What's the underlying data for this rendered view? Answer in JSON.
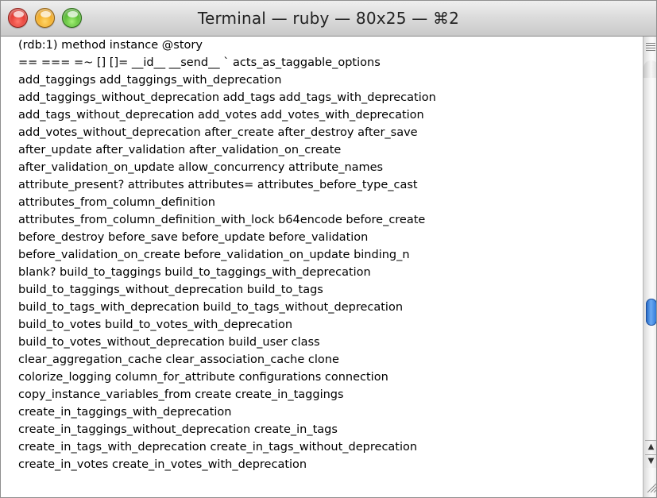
{
  "window": {
    "title": "Terminal — ruby — 80x25 — ⌘2"
  },
  "icons": {
    "close": "close-button",
    "minimize": "minimize-button",
    "zoom": "zoom-button",
    "scroll_up": "arrow-up-icon",
    "scroll_down": "arrow-down-icon",
    "resize": "resize-grip-icon"
  },
  "colors": {
    "scroll_thumb": "#3a86e0",
    "close": "#e0312a",
    "minimize": "#f0a61a",
    "zoom": "#4fb62a"
  },
  "scrollbar": {
    "up_glyph": "▲",
    "down_glyph": "▼"
  },
  "terminal": {
    "lines": [
      "(rdb:1) method instance @story",
      "== === =~ [] []= __id__ __send__ ` acts_as_taggable_options",
      "add_taggings add_taggings_with_deprecation",
      "add_taggings_without_deprecation add_tags add_tags_with_deprecation",
      "add_tags_without_deprecation add_votes add_votes_with_deprecation",
      "add_votes_without_deprecation after_create after_destroy after_save",
      "after_update after_validation after_validation_on_create",
      "after_validation_on_update allow_concurrency attribute_names",
      "attribute_present? attributes attributes= attributes_before_type_cast",
      "attributes_from_column_definition",
      "attributes_from_column_definition_with_lock b64encode before_create",
      "before_destroy before_save before_update before_validation",
      "before_validation_on_create before_validation_on_update binding_n",
      "blank? build_to_taggings build_to_taggings_with_deprecation",
      "build_to_taggings_without_deprecation build_to_tags",
      "build_to_tags_with_deprecation build_to_tags_without_deprecation",
      "build_to_votes build_to_votes_with_deprecation",
      "build_to_votes_without_deprecation build_user class",
      "clear_aggregation_cache clear_association_cache clone",
      "colorize_logging column_for_attribute configurations connection",
      "copy_instance_variables_from create create_in_taggings",
      "create_in_taggings_with_deprecation",
      "create_in_taggings_without_deprecation create_in_tags",
      "create_in_tags_with_deprecation create_in_tags_without_deprecation",
      "create_in_votes create_in_votes_with_deprecation"
    ]
  }
}
